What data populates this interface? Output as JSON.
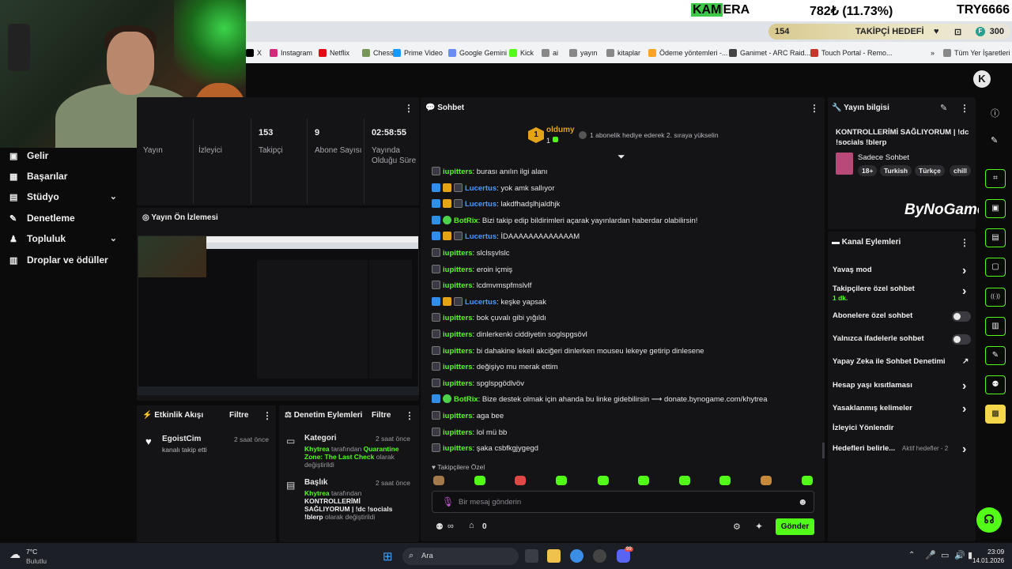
{
  "ticker": {
    "symbol_hl": "KAM",
    "symbol_rest": "ERA",
    "value": "782₺ (11.73%)",
    "pair": "TRY6666"
  },
  "goal": {
    "count": "154",
    "label": "TAKİPÇİ HEDEFİ",
    "end_count": "300",
    "end_badge": "F"
  },
  "bookmarks": [
    {
      "label": "X",
      "color": "#000000"
    },
    {
      "label": "Instagram",
      "color": "#d6297a"
    },
    {
      "label": "Netflix",
      "color": "#e50914"
    },
    {
      "label": "Chess",
      "color": "#769656"
    },
    {
      "label": "Prime Video",
      "color": "#1a98ff"
    },
    {
      "label": "Google Gemini",
      "color": "#6b8cf2"
    },
    {
      "label": "Kick",
      "color": "#53fc18"
    },
    {
      "label": "ai",
      "color": "#888888"
    },
    {
      "label": "yayın",
      "color": "#888888"
    },
    {
      "label": "kitaplar",
      "color": "#888888"
    },
    {
      "label": "Ödeme yöntemleri -...",
      "color": "#f5a623"
    },
    {
      "label": "Ganimet - ARC Raid...",
      "color": "#444444"
    },
    {
      "label": "Touch Portal - Remo...",
      "color": "#c0392b"
    },
    {
      "label": "»",
      "color": "transparent"
    },
    {
      "label": "Tüm Yer İşaretleri",
      "color": "#888888"
    }
  ],
  "nav": [
    {
      "label": "Gelir",
      "icon": "▣"
    },
    {
      "label": "Başarılar",
      "icon": "▦"
    },
    {
      "label": "Stüdyo",
      "icon": "▤",
      "chevron": "⌄"
    },
    {
      "label": "Denetleme",
      "icon": "✎"
    },
    {
      "label": "Topluluk",
      "icon": "♟",
      "chevron": "⌄"
    },
    {
      "label": "Droplar ve ödüller",
      "icon": "▥"
    }
  ],
  "stats": {
    "cells": [
      {
        "num": "",
        "label": "Yayın"
      },
      {
        "num": "",
        "label": "İzleyici"
      },
      {
        "num": "153",
        "label": "Takipçi"
      },
      {
        "num": "9",
        "label": "Abone Sayısı"
      },
      {
        "num": "02:58:55",
        "label": "Yayında Olduğu Süre"
      }
    ]
  },
  "preview": {
    "title": "Yayın Ön İzlemesi"
  },
  "activity": {
    "title": "Etkinlik Akışı",
    "filter": "Filtre",
    "user": "EgoistCim",
    "time": "2 saat önce",
    "text": "kanalı takip etti"
  },
  "modlog": {
    "title": "Denetim Eylemleri",
    "filter": "Filtre",
    "items": [
      {
        "title": "Kategori",
        "time": "2 saat önce",
        "actor": "Khytrea",
        "mid": " tarafından ",
        "value": "Quarantine Zone: The Last Check",
        "end": " olarak değiştirildi"
      },
      {
        "title": "Başlık",
        "time": "2 saat önce",
        "actor": "Khytrea",
        "mid": " tarafından ",
        "value": "KONTROLLERİMİ SAĞLIYORUM | !dc !socials !blerp",
        "end": " olarak değiştirildi"
      }
    ]
  },
  "chat": {
    "title": "Sohbet",
    "pinned_user": "oldumy",
    "pinned_count": "1",
    "pinned_rank": "1",
    "pinned_msg": "1 abonelik hediye ederek 2. sıraya yükselin",
    "messages": [
      {
        "badges": [
          "k"
        ],
        "user": "iupitters",
        "color": "green",
        "text": ": burası anılın ilgi alanı"
      },
      {
        "badges": [
          "blue",
          "gold",
          "k"
        ],
        "user": "Lucertus",
        "color": "blue",
        "text": ": yok amk sallıyor"
      },
      {
        "badges": [
          "blue",
          "gold",
          "k"
        ],
        "user": "Lucertus",
        "color": "blue",
        "text": ": lakdfhadşlhjaldhjk"
      },
      {
        "badges": [
          "blue",
          "green"
        ],
        "user": "BotRix",
        "color": "green",
        "text": ": Bizi takip edip bildirimleri açarak yayınlardan haberdar olabilirsin!"
      },
      {
        "badges": [
          "blue",
          "gold",
          "k"
        ],
        "user": "Lucertus",
        "color": "blue",
        "text": ": İDAAAAAAAAAAAAAM"
      },
      {
        "badges": [
          "k"
        ],
        "user": "iupitters",
        "color": "green",
        "text": ": slclsşvlslc"
      },
      {
        "badges": [
          "k"
        ],
        "user": "iupitters",
        "color": "green",
        "text": ": eroin içmiş"
      },
      {
        "badges": [
          "k"
        ],
        "user": "iupitters",
        "color": "green",
        "text": ": lcdmvmspfmslvlf"
      },
      {
        "badges": [
          "blue",
          "gold",
          "k"
        ],
        "user": "Lucertus",
        "color": "blue",
        "text": ": keşke yapsak"
      },
      {
        "badges": [
          "k"
        ],
        "user": "iupitters",
        "color": "green",
        "text": ": bok çuvalı gibi yığıldı"
      },
      {
        "badges": [
          "k"
        ],
        "user": "iupitters",
        "color": "green",
        "text": ": dinlerkenki ciddiyetin soglspgsövl"
      },
      {
        "badges": [
          "k"
        ],
        "user": "iupitters",
        "color": "green",
        "text": ": bi dahakine lekeli akciğeri dinlerken mouseu lekeye getirip dinlesene"
      },
      {
        "badges": [
          "k"
        ],
        "user": "iupitters",
        "color": "green",
        "text": ": değişiyo mu merak ettim"
      },
      {
        "badges": [
          "k"
        ],
        "user": "iupitters",
        "color": "green",
        "text": ": spglspgödlvöv"
      },
      {
        "badges": [
          "blue",
          "green"
        ],
        "user": "BotRix",
        "color": "green",
        "text": ": Bize destek olmak için ahanda bu linke gidebilirsin ⟶ donate.bynogame.com/khytrea"
      },
      {
        "badges": [
          "k"
        ],
        "user": "iupitters",
        "color": "green",
        "text": ": aga bee"
      },
      {
        "badges": [
          "k"
        ],
        "user": "iupitters",
        "color": "green",
        "text": ": lol mü bb"
      },
      {
        "badges": [
          "k"
        ],
        "user": "iupitters",
        "color": "green",
        "text": ": şaka csbfkgjygegd"
      }
    ],
    "followers_only": "Takipçilere Özel",
    "input_placeholder": "Bir mesaj gönderin",
    "points": "0",
    "send": "Gönder"
  },
  "stream_info": {
    "title": "Yayın bilgisi",
    "stream_title": "KONTROLLERİMİ SAĞLIYORUM | !dc !socials !blerp",
    "category": "Sadece Sohbet",
    "tags": [
      "18+",
      "Turkish",
      "Türkçe",
      "chill"
    ],
    "overlay_logo": "ByNoGame"
  },
  "channel_actions": {
    "title": "Kanal Eylemleri",
    "items": [
      {
        "label": "Yavaş mod",
        "kind": "chevron"
      },
      {
        "label": "Takipçilere özel sohbet",
        "sub": "1 dk.",
        "kind": "chevron"
      },
      {
        "label": "Abonelere özel sohbet",
        "kind": "toggle"
      },
      {
        "label": "Yalnızca ifadelerle sohbet",
        "kind": "toggle"
      },
      {
        "label": "Yapay Zeka ile Sohbet Denetimi",
        "kind": "external"
      },
      {
        "label": "Hesap yaşı kısıtlaması",
        "kind": "chevron"
      },
      {
        "label": "Yasaklanmış kelimeler",
        "kind": "chevron"
      },
      {
        "label": "İzleyici Yönlendir",
        "kind": "none"
      },
      {
        "label": "Hedefleri belirle...",
        "sub": "Aktif hedefler - 2",
        "kind": "chevron"
      }
    ]
  },
  "taskbar": {
    "weather_temp": "7°C",
    "weather_desc": "Bulutlu",
    "search": "Ara",
    "time": "23:09",
    "date": "14.01.2026",
    "notif_badge": "99"
  },
  "colors": {
    "kick_green": "#53fc18",
    "accent_blue": "#4a9cff"
  }
}
